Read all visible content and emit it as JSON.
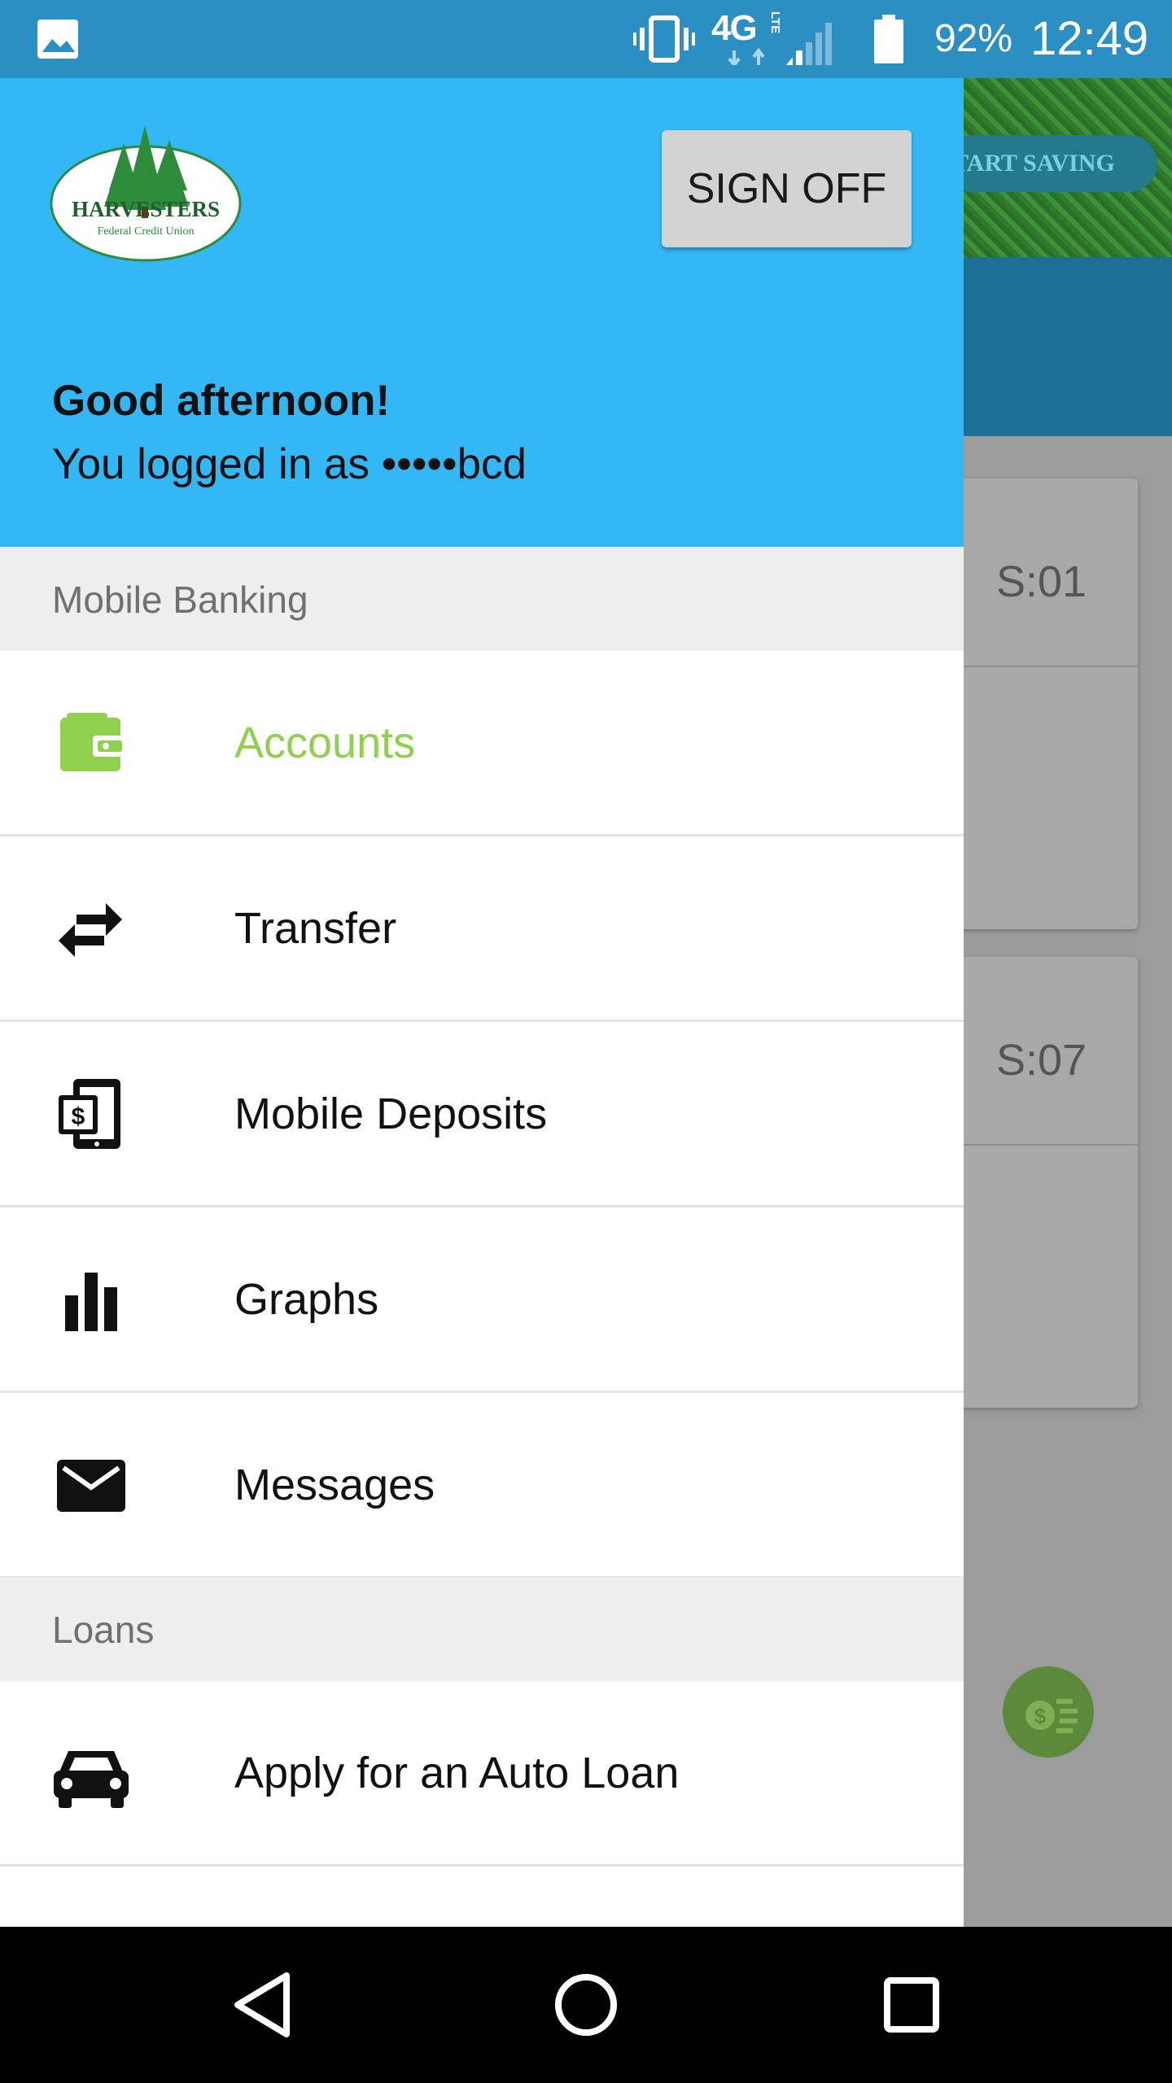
{
  "status_bar": {
    "network": "4G",
    "network_sub": "LTE",
    "battery_percent": "92%",
    "time": "12:49",
    "icons": [
      "image-icon",
      "vibrate-icon",
      "data-arrows-icon",
      "signal-icon",
      "battery-icon"
    ]
  },
  "background_app": {
    "banner_button": "TART SAVING",
    "cards": [
      {
        "code": "S:01"
      },
      {
        "code": "S:07"
      }
    ],
    "fab_icon": "dollar-coins-icon"
  },
  "drawer": {
    "logo": {
      "name": "HARVESTERS",
      "subtitle": "Federal Credit Union"
    },
    "sign_off_label": "SIGN OFF",
    "greeting": "Good afternoon!",
    "login_line": "You logged in as •••••bcd",
    "sections": [
      {
        "title": "Mobile Banking",
        "items": [
          {
            "label": "Accounts",
            "icon": "wallet-icon",
            "active": true
          },
          {
            "label": "Transfer",
            "icon": "swap-arrows-icon"
          },
          {
            "label": "Mobile Deposits",
            "icon": "mobile-deposit-icon"
          },
          {
            "label": "Graphs",
            "icon": "bar-chart-icon"
          },
          {
            "label": "Messages",
            "icon": "envelope-icon"
          }
        ]
      },
      {
        "title": "Loans",
        "items": [
          {
            "label": "Apply for an Auto Loan",
            "icon": "car-icon"
          }
        ]
      }
    ]
  },
  "nav_bar": [
    "back-icon",
    "home-icon",
    "recents-icon"
  ],
  "colors": {
    "header_blue": "#33b8f5",
    "status_blue": "#2b8fc4",
    "active_green": "#8fd14f"
  }
}
